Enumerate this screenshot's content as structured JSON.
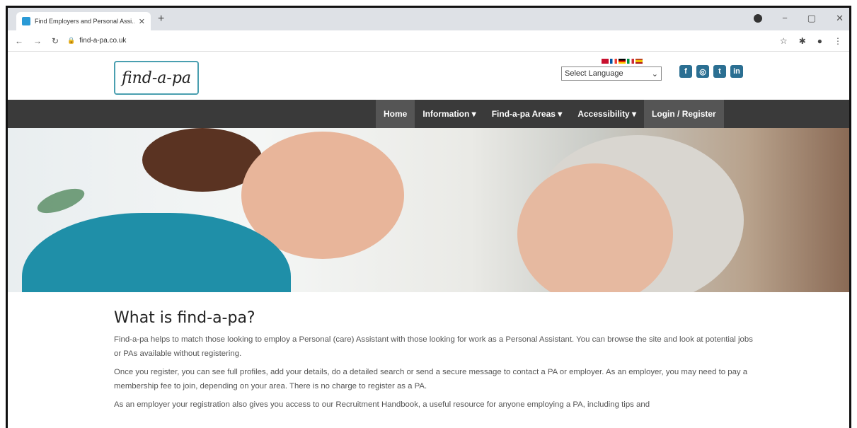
{
  "browser": {
    "tab_title": "Find Employers and Personal Assi...",
    "url": "find-a-pa.co.uk"
  },
  "site": {
    "logo_text": "find-a-pa",
    "language_select": "Select Language",
    "social": [
      "f",
      "◎",
      "t",
      "in"
    ]
  },
  "nav": {
    "items": [
      {
        "label": "Home"
      },
      {
        "label": "Information ▾"
      },
      {
        "label": "Find-a-pa Areas ▾"
      },
      {
        "label": "Accessibility ▾"
      },
      {
        "label": "Login / Register"
      }
    ]
  },
  "main": {
    "heading": "What is find-a-pa?",
    "paragraphs": [
      "Find-a-pa helps to match those looking to employ a Personal (care) Assistant with those looking for work as a Personal Assistant. You can browse the site and look at potential jobs or PAs available without registering.",
      "Once you register, you can see full profiles, add your details, do a detailed search or send a secure message to contact a PA or employer. As an employer, you may need to pay a membership fee to join, depending on your area. There is no charge to register as a PA.",
      "As an employer your registration also gives you access to our Recruitment Handbook, a useful resource for anyone employing a PA, including tips and"
    ]
  },
  "colors": {
    "navbar": "#3a3a3a",
    "accent": "#2b6f92",
    "logo_border": "#4a9fb0"
  }
}
